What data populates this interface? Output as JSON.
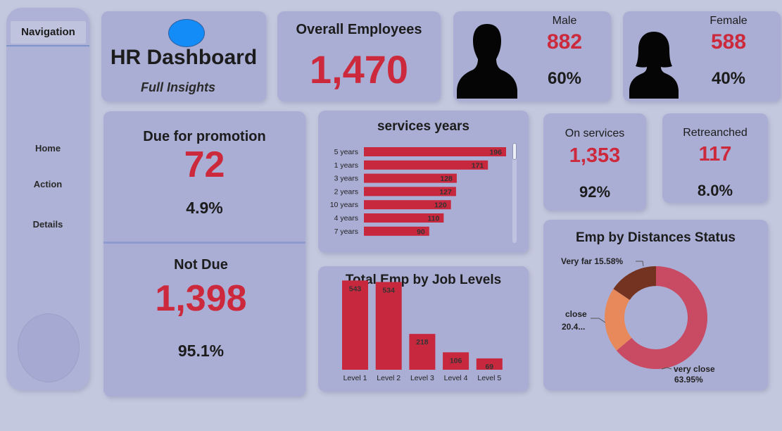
{
  "nav": {
    "title": "Navigation",
    "items": [
      {
        "label": "Home"
      },
      {
        "label": "Action"
      },
      {
        "label": "Details"
      }
    ]
  },
  "header": {
    "title": "HR Dashboard",
    "subtitle": "Full Insights"
  },
  "overall": {
    "label": "Overall Employees",
    "value": "1,470"
  },
  "male": {
    "label": "Male",
    "count": "882",
    "pct": "60%"
  },
  "female": {
    "label": "Female",
    "count": "588",
    "pct": "40%"
  },
  "promotion": {
    "due_label": "Due for promotion",
    "due_value": "72",
    "due_pct": "4.9%",
    "not_due_label": "Not Due",
    "not_due_value": "1,398",
    "not_due_pct": "95.1%"
  },
  "on_services": {
    "label": "On services",
    "value": "1,353",
    "pct": "92%"
  },
  "retrenched": {
    "label": "Retreanched",
    "value": "117",
    "pct": "8.0%"
  },
  "colors": {
    "accent": "#cc2a3c",
    "bar": "#c8283e",
    "card": "#aaaed4",
    "background": "#c4c8de"
  },
  "chart_data": [
    {
      "type": "bar",
      "orientation": "horizontal",
      "title": "services years",
      "categories": [
        "5 years",
        "1 years",
        "3 years",
        "2 years",
        "10 years",
        "4 years",
        "7 years"
      ],
      "values": [
        196,
        171,
        128,
        127,
        120,
        110,
        90
      ],
      "xlim": [
        0,
        196
      ]
    },
    {
      "type": "bar",
      "title": "Total Emp by Job Levels",
      "categories": [
        "Level 1",
        "Level 2",
        "Level 3",
        "Level 4",
        "Level 5"
      ],
      "values": [
        543,
        534,
        218,
        106,
        69
      ],
      "ylim": [
        0,
        600
      ]
    },
    {
      "type": "pie",
      "donut": true,
      "title": "Emp by Distances Status",
      "slices": [
        {
          "label": "very close",
          "pct_label": "63.95%",
          "value": 63.95,
          "color": "#c94a63"
        },
        {
          "label": "close",
          "pct_label": "20.4...",
          "value": 20.47,
          "color": "#e8895c"
        },
        {
          "label": "Very far",
          "pct_label": "15.58%",
          "value": 15.58,
          "color": "#743320"
        }
      ]
    }
  ]
}
